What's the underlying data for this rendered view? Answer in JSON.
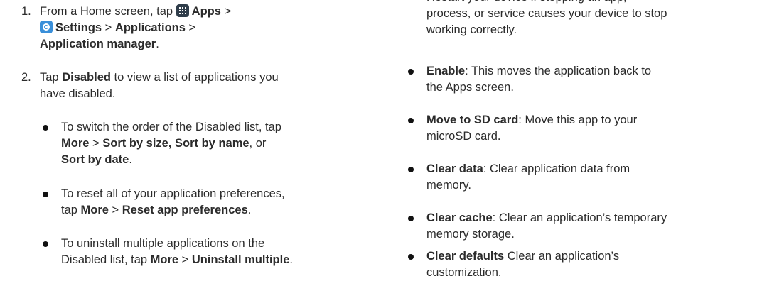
{
  "left": {
    "step1": {
      "number": "1.",
      "t1": "From a Home screen, tap ",
      "apps": "Apps",
      "sep1": " >",
      "settings": "Settings",
      "sep2": " > ",
      "applications": "Applications",
      "sep3": " >",
      "app_manager": "Application manager",
      "end": "."
    },
    "step2": {
      "number": "2.",
      "t1": "Tap ",
      "disabled": "Disabled",
      "t2": " to view a list of applications you",
      "t3": "have disabled."
    },
    "bullet1": {
      "t1": "To switch the order of the Disabled list, tap",
      "more": "More",
      "sep": " > ",
      "sort_size": "Sort by size, Sort by name",
      "or": ", or",
      "sort_date": "Sort by date",
      "end": "."
    },
    "bullet2": {
      "t1": "To reset all of your application preferences,",
      "t2": "tap ",
      "more": "More",
      "sep": " > ",
      "reset": "Reset app preferences",
      "end": "."
    },
    "bullet3": {
      "t1": "To uninstall multiple applications on the",
      "t2": "Disabled list, tap ",
      "more": "More",
      "sep": " > ",
      "uninstall": "Uninstall multiple",
      "end": "."
    }
  },
  "right": {
    "top": {
      "l1": "Restart your device if stopping an app,",
      "l2": "process, or service causes your device to stop",
      "l3": "working correctly."
    },
    "enable": {
      "term": "Enable",
      "t1": ": This moves the application back to",
      "t2": "the Apps screen."
    },
    "move_sd": {
      "term": "Move to SD card",
      "t1": ": Move this app to your",
      "t2": "microSD card."
    },
    "clear_data": {
      "term": "Clear data",
      "t1": ": Clear application data from",
      "t2": "memory."
    },
    "clear_cache": {
      "term": "Clear cache",
      "t1": ": Clear an application’s temporary",
      "t2": "memory storage."
    },
    "clear_defaults": {
      "term": "Clear defaults",
      "t1": " Clear an application’s",
      "t2": "customization."
    }
  },
  "icons": {
    "apps": "apps-grid-icon",
    "settings": "settings-gear-icon"
  }
}
